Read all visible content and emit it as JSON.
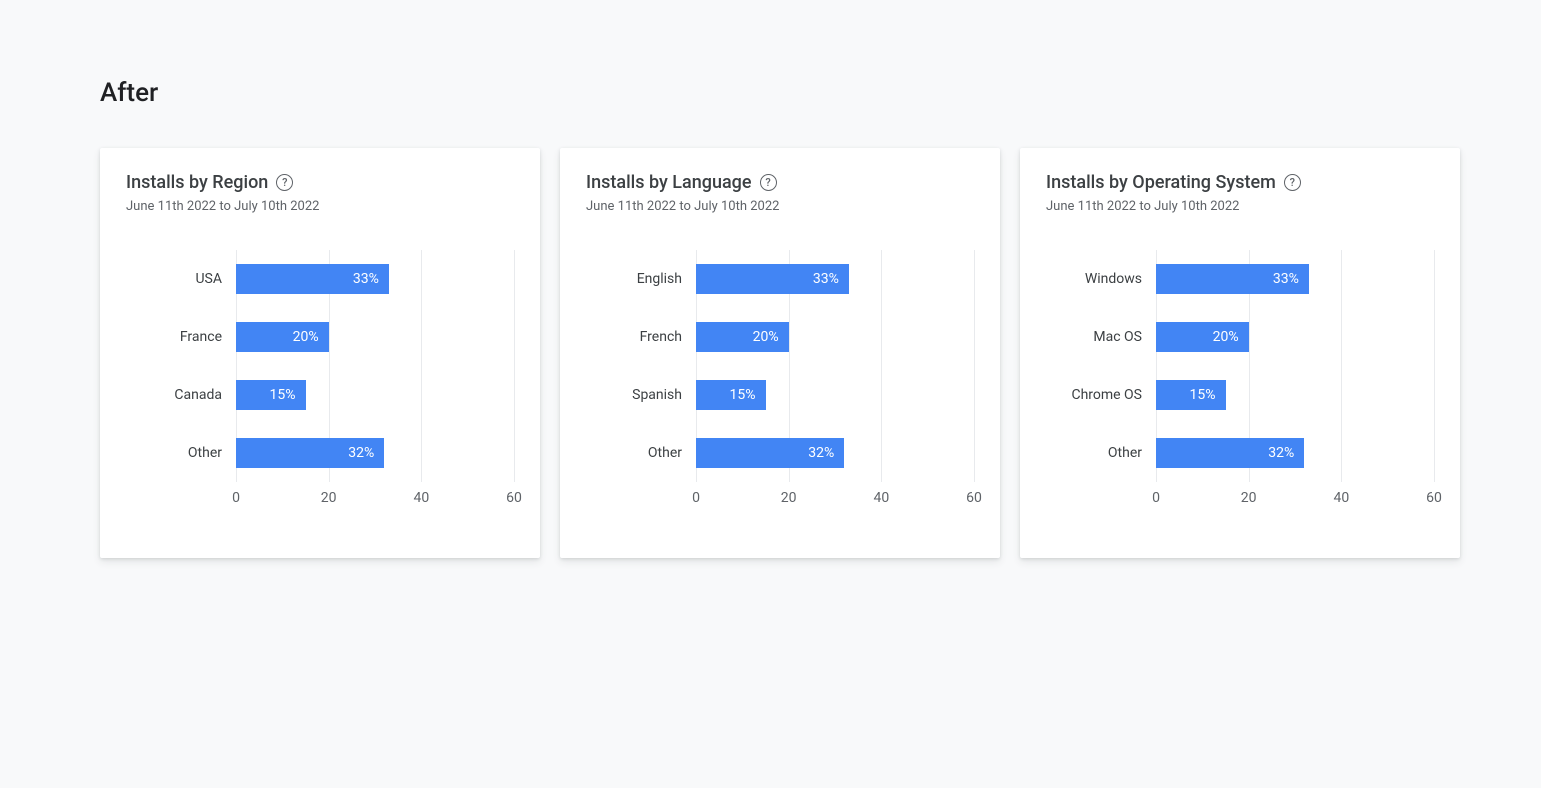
{
  "page_title": "After",
  "date_range": "June 11th 2022 to July 10th 2022",
  "axis_max": 60,
  "ticks": [
    0,
    20,
    40,
    60
  ],
  "cards": [
    {
      "title": "Installs by Region",
      "rows": [
        {
          "label": "USA",
          "value": 33,
          "display": "33%"
        },
        {
          "label": "France",
          "value": 20,
          "display": "20%"
        },
        {
          "label": "Canada",
          "value": 15,
          "display": "15%"
        },
        {
          "label": "Other",
          "value": 32,
          "display": "32%"
        }
      ]
    },
    {
      "title": "Installs by Language",
      "rows": [
        {
          "label": "English",
          "value": 33,
          "display": "33%"
        },
        {
          "label": "French",
          "value": 20,
          "display": "20%"
        },
        {
          "label": "Spanish",
          "value": 15,
          "display": "15%"
        },
        {
          "label": "Other",
          "value": 32,
          "display": "32%"
        }
      ]
    },
    {
      "title": "Installs by Operating System",
      "rows": [
        {
          "label": "Windows",
          "value": 33,
          "display": "33%"
        },
        {
          "label": "Mac OS",
          "value": 20,
          "display": "20%"
        },
        {
          "label": "Chrome OS",
          "value": 15,
          "display": "15%"
        },
        {
          "label": "Other",
          "value": 32,
          "display": "32%"
        }
      ]
    }
  ],
  "chart_data": [
    {
      "type": "bar",
      "orientation": "horizontal",
      "title": "Installs by Region",
      "subtitle": "June 11th 2022 to July 10th 2022",
      "categories": [
        "USA",
        "France",
        "Canada",
        "Other"
      ],
      "values": [
        33,
        20,
        15,
        32
      ],
      "value_labels": [
        "33%",
        "20%",
        "15%",
        "32%"
      ],
      "xlabel": "",
      "ylabel": "",
      "xlim": [
        0,
        60
      ],
      "xticks": [
        0,
        20,
        40,
        60
      ]
    },
    {
      "type": "bar",
      "orientation": "horizontal",
      "title": "Installs by Language",
      "subtitle": "June 11th 2022 to July 10th 2022",
      "categories": [
        "English",
        "French",
        "Spanish",
        "Other"
      ],
      "values": [
        33,
        20,
        15,
        32
      ],
      "value_labels": [
        "33%",
        "20%",
        "15%",
        "32%"
      ],
      "xlabel": "",
      "ylabel": "",
      "xlim": [
        0,
        60
      ],
      "xticks": [
        0,
        20,
        40,
        60
      ]
    },
    {
      "type": "bar",
      "orientation": "horizontal",
      "title": "Installs by Operating System",
      "subtitle": "June 11th 2022 to July 10th 2022",
      "categories": [
        "Windows",
        "Mac OS",
        "Chrome OS",
        "Other"
      ],
      "values": [
        33,
        20,
        15,
        32
      ],
      "value_labels": [
        "33%",
        "20%",
        "15%",
        "32%"
      ],
      "xlabel": "",
      "ylabel": "",
      "xlim": [
        0,
        60
      ],
      "xticks": [
        0,
        20,
        40,
        60
      ]
    }
  ]
}
